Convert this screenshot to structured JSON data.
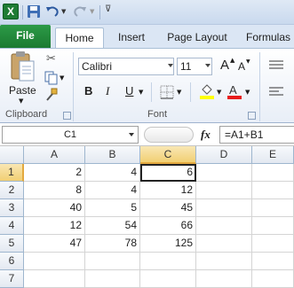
{
  "app": {
    "logo": "X"
  },
  "qat": {
    "icons": [
      "save-icon",
      "undo-icon",
      "redo-icon",
      "customize-icon"
    ]
  },
  "tabs": [
    {
      "label": "File"
    },
    {
      "label": "Home"
    },
    {
      "label": "Insert"
    },
    {
      "label": "Page Layout"
    },
    {
      "label": "Formulas"
    }
  ],
  "ribbon": {
    "clipboard": {
      "label": "Clipboard",
      "paste_label": "Paste"
    },
    "font": {
      "label": "Font",
      "name": "Calibri",
      "size": "11",
      "bold": "B",
      "italic": "I",
      "underline": "U",
      "grow": "A",
      "shrink": "A"
    }
  },
  "formula_bar": {
    "name_box": "C1",
    "fx": "fx",
    "formula": "=A1+B1"
  },
  "grid": {
    "columns": [
      "A",
      "B",
      "C",
      "D",
      "E"
    ],
    "rows": [
      {
        "n": "1",
        "cells": [
          "2",
          "4",
          "6",
          "",
          ""
        ]
      },
      {
        "n": "2",
        "cells": [
          "8",
          "4",
          "12",
          "",
          ""
        ]
      },
      {
        "n": "3",
        "cells": [
          "40",
          "5",
          "45",
          "",
          ""
        ]
      },
      {
        "n": "4",
        "cells": [
          "12",
          "54",
          "66",
          "",
          ""
        ]
      },
      {
        "n": "5",
        "cells": [
          "47",
          "78",
          "125",
          "",
          ""
        ]
      },
      {
        "n": "6",
        "cells": [
          "",
          "",
          "",
          "",
          ""
        ]
      },
      {
        "n": "7",
        "cells": [
          "",
          "",
          "",
          "",
          ""
        ]
      }
    ]
  },
  "colors": {
    "file_tab": "#1b7a31",
    "font_color": "#e81c1c",
    "highlight": "#ffff00"
  }
}
